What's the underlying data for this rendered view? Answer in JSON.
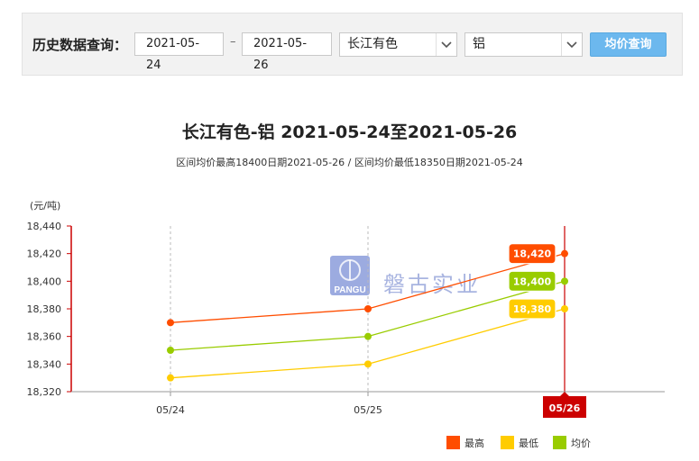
{
  "query": {
    "label": "历史数据查询：",
    "start_date": "2021-05-24",
    "separator": "–",
    "end_date": "2021-05-26",
    "market_select": "长江有色",
    "metal_select": "铝",
    "button_label": "均价查询"
  },
  "watermark": {
    "logo_text": "PANGU",
    "company_text": "磐古实业"
  },
  "colors": {
    "high": "#ff4d00",
    "low": "#ffcc00",
    "avg": "#99cc00",
    "axis": "#cc0000",
    "button": "#6cb8ee"
  },
  "chart_data": {
    "type": "line",
    "title": "长江有色-铝 2021-05-24至2021-05-26",
    "subtitle": "区间均价最高18400日期2021-05-26 / 区间均价最低18350日期2021-05-24",
    "ylabel": "(元/吨)",
    "xlabel": "",
    "categories": [
      "05/24",
      "05/25",
      "05/26"
    ],
    "ylim": [
      18320,
      18440
    ],
    "yticks": [
      "18,440",
      "18,420",
      "18,400",
      "18,380",
      "18,360",
      "18,340",
      "18,320"
    ],
    "grid": "vertical dashed",
    "legend_position": "bottom-right",
    "highlight_category": "05/26",
    "series": [
      {
        "name": "最高",
        "color": "#ff4d00",
        "values": [
          18370,
          18380,
          18420
        ],
        "last_label": "18,420"
      },
      {
        "name": "最低",
        "color": "#ffcc00",
        "values": [
          18330,
          18340,
          18380
        ],
        "last_label": "18,380"
      },
      {
        "name": "均价",
        "color": "#99cc00",
        "values": [
          18350,
          18360,
          18400
        ],
        "last_label": "18,400"
      }
    ]
  }
}
